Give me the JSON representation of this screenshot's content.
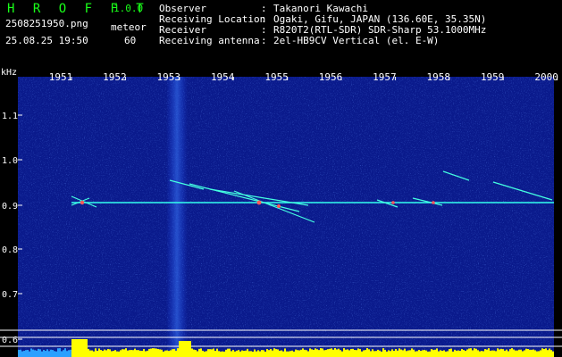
{
  "app": {
    "name": "H R O F F T",
    "version": "1.0.0"
  },
  "file": {
    "name": "2508251950.png",
    "type": "meteor",
    "datetime": "25.08.25 19:50",
    "count": "60"
  },
  "info": [
    {
      "key": "Observer",
      "value": "Takanori Kawachi"
    },
    {
      "key": "Receiving Location",
      "value": "Ogaki, Gifu, JAPAN (136.60E, 35.35N)"
    },
    {
      "key": "Receiver",
      "value": "R820T2(RTL-SDR) SDR-Sharp 53.1000MHz"
    },
    {
      "key": "Receiving antenna",
      "value": "2el-HB9CV Vertical (el. E-W)"
    }
  ],
  "spectrogram": {
    "y_unit": "kHz",
    "y_ticks": [
      "1.1",
      "1.0",
      "0.9",
      "0.8",
      "0.7",
      "0.6"
    ],
    "x_ticks": [
      "1951",
      "1952",
      "1953",
      "1954",
      "1955",
      "1956",
      "1957",
      "1958",
      "1959",
      "2000"
    ],
    "colors": {
      "background": "#0a1a8c",
      "signal": "#33ffee",
      "bars": "#ffff00",
      "grid": "#ffffff"
    }
  }
}
